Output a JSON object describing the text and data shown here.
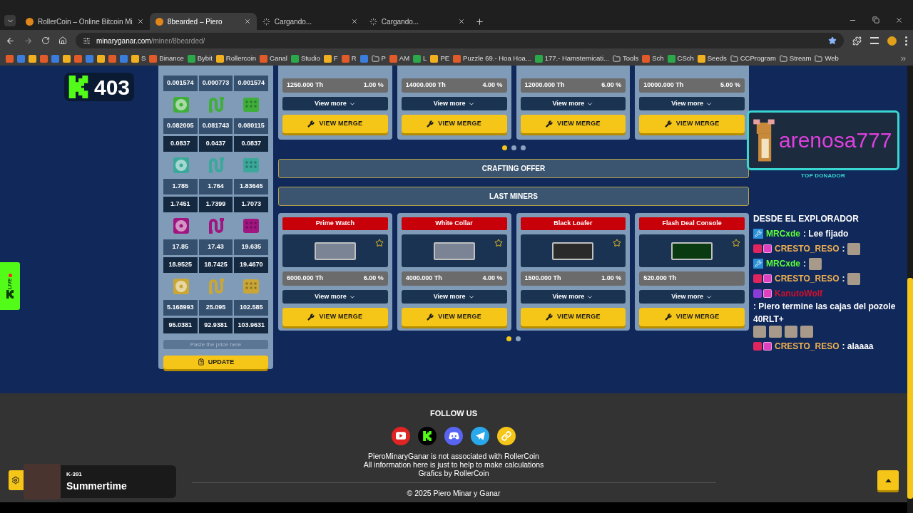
{
  "browser": {
    "tabs": [
      {
        "title": "RollerCoin – Online Bitcoin Mi",
        "selected": false,
        "loading": false
      },
      {
        "title": "8bearded – Piero",
        "selected": true,
        "loading": false
      },
      {
        "title": "Cargando...",
        "selected": false,
        "loading": true
      },
      {
        "title": "Cargando...",
        "selected": false,
        "loading": true
      }
    ],
    "url_host": "minaryganar.com",
    "url_path": "/miner/8bearded/",
    "bookmarks": [
      {
        "kind": "icon"
      },
      {
        "kind": "icon"
      },
      {
        "kind": "icon"
      },
      {
        "kind": "icon"
      },
      {
        "kind": "icon"
      },
      {
        "kind": "icon"
      },
      {
        "kind": "icon"
      },
      {
        "kind": "icon"
      },
      {
        "kind": "icon"
      },
      {
        "kind": "icon"
      },
      {
        "kind": "icon"
      },
      {
        "kind": "site",
        "label": "S"
      },
      {
        "kind": "site",
        "label": "Binance"
      },
      {
        "kind": "site",
        "label": "Bybit"
      },
      {
        "kind": "site",
        "label": "Rollercoin"
      },
      {
        "kind": "site",
        "label": "Canal"
      },
      {
        "kind": "site",
        "label": "Studio"
      },
      {
        "kind": "site",
        "label": "F"
      },
      {
        "kind": "site",
        "label": "R"
      },
      {
        "kind": "icon"
      },
      {
        "kind": "folder",
        "label": "P"
      },
      {
        "kind": "site",
        "label": "AM"
      },
      {
        "kind": "site",
        "label": "L"
      },
      {
        "kind": "site",
        "label": "PE"
      },
      {
        "kind": "site",
        "label": "Puzzle 69.- Hoa Hoa..."
      },
      {
        "kind": "site",
        "label": "177.- Hamsternicati..."
      },
      {
        "kind": "folder",
        "label": "Tools"
      },
      {
        "kind": "site",
        "label": "Sch"
      },
      {
        "kind": "site",
        "label": "CSch"
      },
      {
        "kind": "site",
        "label": "Seeds"
      },
      {
        "kind": "folder",
        "label": "CCProgram"
      },
      {
        "kind": "folder",
        "label": "Stream"
      },
      {
        "kind": "folder",
        "label": "Web"
      }
    ]
  },
  "k_badge": {
    "count": "403"
  },
  "live_tab": {
    "label": "LIVE"
  },
  "parts_table": [
    {
      "rows": [
        [
          "0.001574",
          "0.000773",
          "0.001574"
        ]
      ]
    },
    {
      "color": "#3fae3a",
      "rows": [
        [
          "0.082005",
          "0.081743",
          "0.080115"
        ],
        [
          "0.0837",
          "0.0437",
          "0.0837"
        ]
      ]
    },
    {
      "color": "#3aa89a",
      "rows": [
        [
          "1.785",
          "1.764",
          "1.83645"
        ],
        [
          "1.7451",
          "1.7399",
          "1.7073"
        ]
      ]
    },
    {
      "color": "#a0157f",
      "rows": [
        [
          "17.85",
          "17.43",
          "19.635"
        ],
        [
          "18.9525",
          "18.7425",
          "19.4670"
        ]
      ]
    },
    {
      "color": "#c9a636",
      "rows": [
        [
          "5.168993",
          "25.095",
          "102.585"
        ],
        [
          "95.0381",
          "92.9381",
          "103.9631"
        ]
      ]
    }
  ],
  "price_field": {
    "placeholder": "Paste the price here"
  },
  "update_button": "UPDATE",
  "top_miners": [
    {
      "power": "1250.000 Th",
      "percent": "1.00 %",
      "view_more": "View more",
      "merge": "VIEW MERGE"
    },
    {
      "power": "14000.000 Th",
      "percent": "4.00 %",
      "view_more": "View more",
      "merge": "VIEW MERGE"
    },
    {
      "power": "12000.000 Th",
      "percent": "6.00 %",
      "view_more": "View more",
      "merge": "VIEW MERGE"
    },
    {
      "power": "10000.000 Th",
      "percent": "5.00 %",
      "view_more": "View more",
      "merge": "VIEW MERGE"
    }
  ],
  "top_dots": [
    {
      "selected": true
    },
    {
      "selected": false
    },
    {
      "selected": false
    }
  ],
  "sections": [
    "CRAFTING OFFER",
    "LAST MINERS"
  ],
  "last_miners": [
    {
      "name": "Prime Watch",
      "power": "6000.000 Th",
      "percent": "6.00 %",
      "favorite": false,
      "view_more": "View more",
      "merge": "VIEW MERGE"
    },
    {
      "name": "White Collar",
      "power": "4000.000 Th",
      "percent": "4.00 %",
      "favorite": false,
      "view_more": "View more",
      "merge": "VIEW MERGE"
    },
    {
      "name": "Black Loafer",
      "power": "1500.000 Th",
      "percent": "1.00 %",
      "favorite": false,
      "view_more": "View more",
      "merge": "VIEW MERGE"
    },
    {
      "name": "Flash Deal Console",
      "power": "520.000 Th",
      "favorite": false,
      "view_more": "View more",
      "merge": "VIEW MERGE"
    }
  ],
  "last_dots": [
    {
      "selected": true
    },
    {
      "selected": false
    }
  ],
  "donor": {
    "name": "arenosa777",
    "label": "TOP DONADOR"
  },
  "chat": [
    {
      "parts": [
        {
          "kind": "text",
          "text": "DESDE EL EXPLORADOR"
        }
      ]
    },
    {
      "kind": "mod",
      "user": "MRCxde",
      "color": "#5dff3a",
      "parts": [
        {
          "kind": "text",
          "text": ": Lee fijado"
        }
      ]
    },
    {
      "kind": "sub",
      "user": "CRESTO_RESO",
      "color": "#f0b050",
      "parts": [
        {
          "kind": "text",
          "text": ":"
        },
        {
          "kind": "emote"
        }
      ]
    },
    {
      "kind": "mod",
      "user": "MRCxde",
      "color": "#5dff3a",
      "parts": [
        {
          "kind": "text",
          "text": ":"
        },
        {
          "kind": "emote"
        }
      ]
    },
    {
      "kind": "sub",
      "user": "CRESTO_RESO",
      "color": "#f0b050",
      "parts": [
        {
          "kind": "text",
          "text": ":"
        },
        {
          "kind": "emote"
        }
      ]
    },
    {
      "kind": "sub-purple",
      "user": "KanutoWolf",
      "color": "#d0102c",
      "parts": [
        {
          "kind": "text",
          "text": ": Piero termine las cajas del pozole 40RLT+"
        },
        {
          "kind": "emote"
        },
        {
          "kind": "emote"
        },
        {
          "kind": "emote"
        },
        {
          "kind": "emote"
        }
      ]
    },
    {
      "kind": "sub",
      "user": "CRESTO_RESO",
      "color": "#f0b050",
      "parts": [
        {
          "kind": "text",
          "text": ": alaaaa"
        }
      ]
    }
  ],
  "footer": {
    "title": "FOLLOW US",
    "socials": [
      {
        "kind": "youtube"
      },
      {
        "kind": "kick"
      },
      {
        "kind": "discord"
      },
      {
        "kind": "telegram"
      },
      {
        "kind": "link"
      }
    ],
    "lines": [
      "PieroMinaryGanar is not associated with RollerCoin",
      "All information here is just to help to make calculations",
      "Grafics by RollerCoin"
    ],
    "copyright": "© 2025 Piero Minar y Ganar"
  },
  "now_playing": {
    "artist": "K-391",
    "title": "Summertime"
  }
}
